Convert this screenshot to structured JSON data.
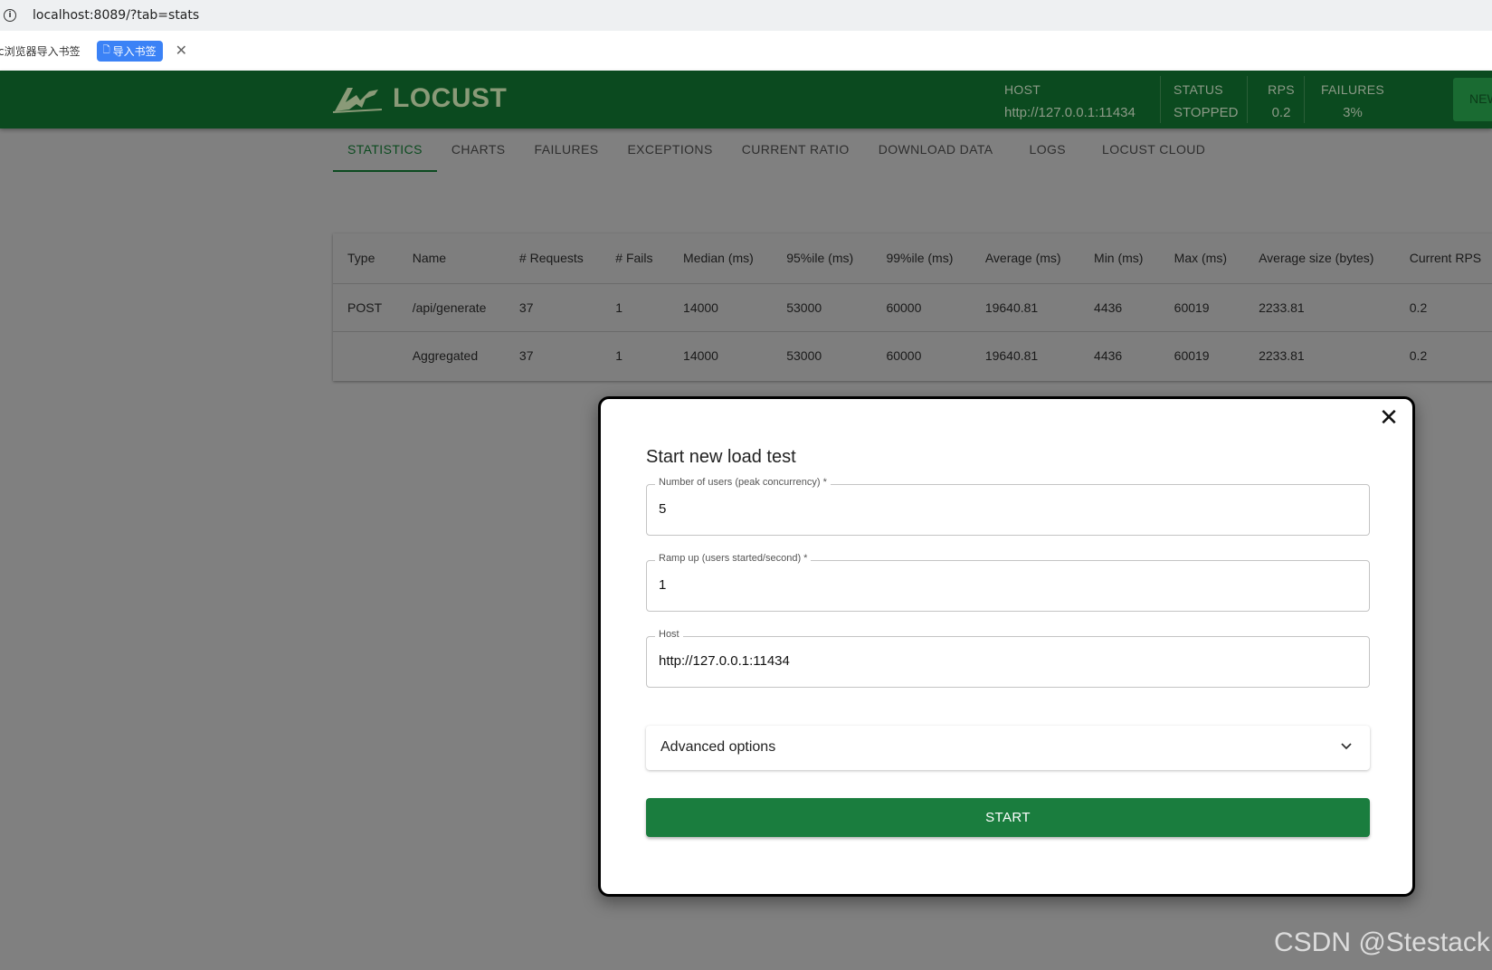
{
  "browser": {
    "url": "localhost:8089/?tab=stats",
    "bookmark_text": "c浏览器导入书签",
    "import_button": "导入书签"
  },
  "header": {
    "logo_text": "LOCUST",
    "host_label": "HOST",
    "host_value": "http://127.0.0.1:11434",
    "status_label": "STATUS",
    "status_value": "STOPPED",
    "rps_label": "RPS",
    "rps_value": "0.2",
    "failures_label": "FAILURES",
    "failures_value": "3%",
    "new_button": "NEW"
  },
  "tabs": [
    "STATISTICS",
    "CHARTS",
    "FAILURES",
    "EXCEPTIONS",
    "CURRENT RATIO",
    "DOWNLOAD DATA",
    "LOGS",
    "LOCUST CLOUD"
  ],
  "table": {
    "columns": [
      "Type",
      "Name",
      "# Requests",
      "# Fails",
      "Median (ms)",
      "95%ile (ms)",
      "99%ile (ms)",
      "Average (ms)",
      "Min (ms)",
      "Max (ms)",
      "Average size (bytes)",
      "Current RPS"
    ],
    "rows": [
      [
        "POST",
        "/api/generate",
        "37",
        "1",
        "14000",
        "53000",
        "60000",
        "19640.81",
        "4436",
        "60019",
        "2233.81",
        "0.2"
      ],
      [
        "",
        "Aggregated",
        "37",
        "1",
        "14000",
        "53000",
        "60000",
        "19640.81",
        "4436",
        "60019",
        "2233.81",
        "0.2"
      ]
    ]
  },
  "modal": {
    "title": "Start new load test",
    "users_label": "Number of users (peak concurrency) *",
    "users_value": "5",
    "ramp_label": "Ramp up (users started/second) *",
    "ramp_value": "1",
    "host_label": "Host",
    "host_value": "http://127.0.0.1:11434",
    "advanced_label": "Advanced options",
    "start_label": "START"
  },
  "watermark": "CSDN @Stestack",
  "colors": {
    "header_bg": "#0b4a1f",
    "start_button": "#1a7d3e",
    "overlay": "#808080",
    "bookmark_button": "#3b82f6"
  }
}
